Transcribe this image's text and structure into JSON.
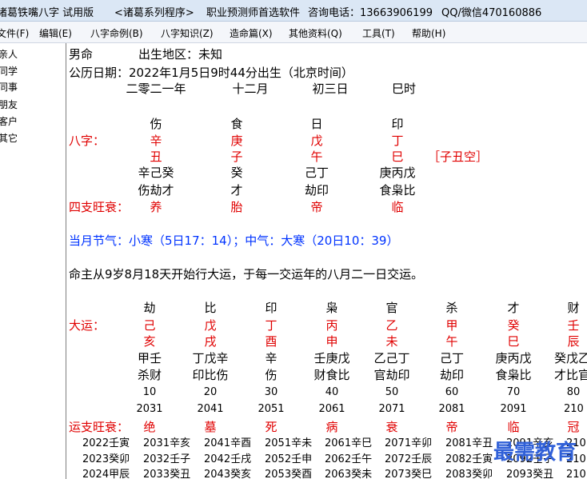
{
  "titlebar": {
    "app": "诸葛铁嘴八字 试用版",
    "series": "<诸葛系列程序>",
    "slogan": "职业预测师首选软件",
    "phone": "咨询电话：13663906199",
    "qq": "QQ/微信470160886"
  },
  "menu": [
    "文件(F)",
    "编辑(E)",
    "八字命例(B)",
    "八字知识(Z)",
    "造命篇(X)",
    "其他资料(Q)",
    "工具(T)",
    "帮助(H)"
  ],
  "sidebar": [
    "亲人",
    "同学",
    "同事",
    "朋友",
    "客户",
    "其它"
  ],
  "header": {
    "gender": "男命",
    "birthplace": "出生地区：未知",
    "gregorian": "公历日期：2022年1月5日9时44分出生（北京时间）",
    "lunar": [
      "二零二一年",
      "十二月",
      "初三日",
      "巳时"
    ]
  },
  "bazi": {
    "label": "八字：",
    "shishen": [
      "伤",
      "食",
      "日",
      "印"
    ],
    "stems": [
      "辛",
      "庚",
      "戊",
      "丁"
    ],
    "branches": [
      "丑",
      "子",
      "午",
      "巳"
    ],
    "kongwang": "［子丑空］",
    "hidden": [
      "辛己癸",
      "癸",
      "己丁",
      "庚丙戊"
    ],
    "hidden_shishen": [
      "伤劫才",
      "才",
      "劫印",
      "食枭比"
    ],
    "wangshuai_label": "四支旺衰：",
    "wangshuai": [
      "养",
      "胎",
      "帝",
      "临"
    ]
  },
  "jieqi": "当月节气：小寒（5日17：14）；中气：大寒（20日10：39）",
  "dayun_intro": "命主从9岁8月18天开始行大运，于每一交运年的八月二一日交运。",
  "dayun": {
    "label": "大运：",
    "shishen": [
      "劫",
      "比",
      "印",
      "枭",
      "官",
      "杀",
      "才",
      "财"
    ],
    "stems": [
      "己",
      "戊",
      "丁",
      "丙",
      "乙",
      "甲",
      "癸",
      "壬"
    ],
    "branches": [
      "亥",
      "戌",
      "酉",
      "申",
      "未",
      "午",
      "巳",
      "辰"
    ],
    "hidden": [
      "甲壬",
      "丁戊辛",
      "辛",
      "壬庚戊",
      "乙己丁",
      "己丁",
      "庚丙戊",
      "癸戊乙"
    ],
    "hidden_shishen": [
      "杀财",
      "印比伤",
      "伤",
      "财食比",
      "官劫印",
      "劫印",
      "食枭比",
      "才比官"
    ],
    "ages": [
      "10",
      "20",
      "30",
      "40",
      "50",
      "60",
      "70",
      "80"
    ],
    "years": [
      "2031",
      "2041",
      "2051",
      "2061",
      "2071",
      "2081",
      "2091",
      "210"
    ],
    "ws_label": "运支旺衰：",
    "wangshuai": [
      "绝",
      "墓",
      "死",
      "病",
      "衰",
      "帝",
      "临",
      "冠"
    ]
  },
  "liunian": [
    [
      "2022壬寅",
      "2031辛亥",
      "2041辛酉",
      "2051辛未",
      "2061辛巳",
      "2071辛卯",
      "2081辛丑",
      "2091辛亥",
      "210"
    ],
    [
      "2023癸卯",
      "2032壬子",
      "2042壬戌",
      "2052壬申",
      "2062壬午",
      "2072壬辰",
      "2082壬寅",
      "2092壬子",
      "210"
    ],
    [
      "2024甲辰",
      "2033癸丑",
      "2043癸亥",
      "2053癸酉",
      "2063癸未",
      "2073癸巳",
      "2083癸卯",
      "2093癸丑",
      "210"
    ]
  ],
  "watermark": "最需教育"
}
